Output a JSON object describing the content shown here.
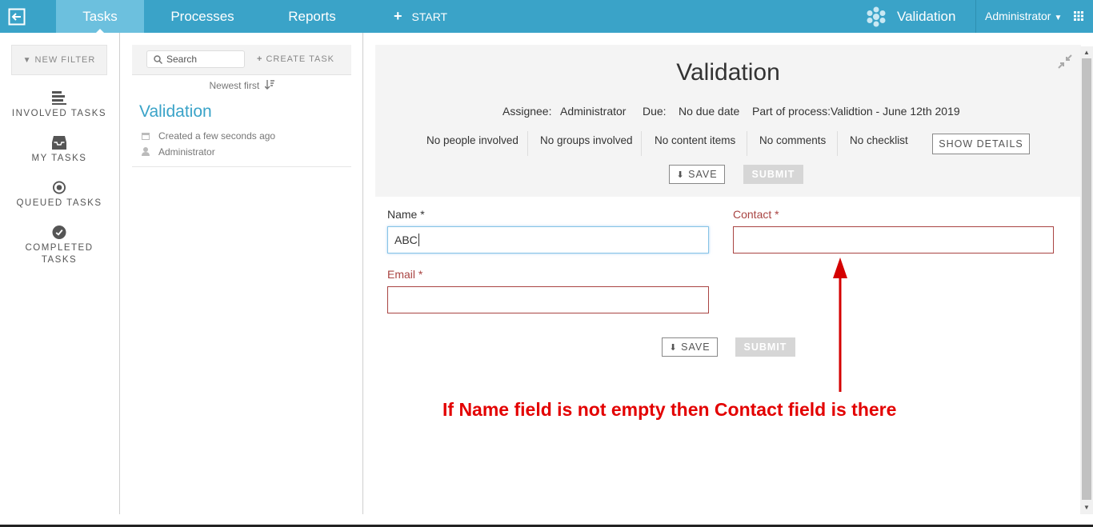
{
  "topbar": {
    "tabs": [
      {
        "label": "Tasks",
        "active": true
      },
      {
        "label": "Processes",
        "active": false
      },
      {
        "label": "Reports",
        "active": false
      }
    ],
    "start_label": "START",
    "app_name": "Validation",
    "user_name": "Administrator",
    "accent_color": "#3aa3c8"
  },
  "sidebar": {
    "new_filter": "NEW FILTER",
    "items": [
      {
        "label": "INVOLVED TASKS",
        "icon": "stack-icon"
      },
      {
        "label": "MY TASKS",
        "icon": "inbox-icon"
      },
      {
        "label": "QUEUED TASKS",
        "icon": "target-icon"
      },
      {
        "label": "COMPLETED",
        "label2": "TASKS",
        "icon": "check-circle-icon"
      }
    ]
  },
  "tasklist": {
    "search_placeholder": "Search",
    "create_task": "CREATE TASK",
    "sort_label": "Newest first",
    "tasks": [
      {
        "title": "Validation",
        "created": "Created a few seconds ago",
        "assignee": "Administrator"
      }
    ]
  },
  "task": {
    "title": "Validation",
    "assignee_label": "Assignee:",
    "assignee": "Administrator",
    "due_label": "Due:",
    "due": "No due date",
    "process_label": "Part of process:",
    "process": "Validtion - June 12th 2019",
    "people": "No people involved",
    "groups": "No groups involved",
    "content": "No content items",
    "comments": "No comments",
    "checklist": "No checklist",
    "show_details": "SHOW DETAILS",
    "save": "SAVE",
    "submit": "SUBMIT"
  },
  "form": {
    "name_label": "Name",
    "name_value": "ABC",
    "contact_label": "Contact",
    "email_label": "Email",
    "required_mark": "*",
    "save": "SAVE",
    "submit": "SUBMIT"
  },
  "annotation": {
    "text": "If Name field is not empty then Contact field is there",
    "color": "#e30000"
  }
}
